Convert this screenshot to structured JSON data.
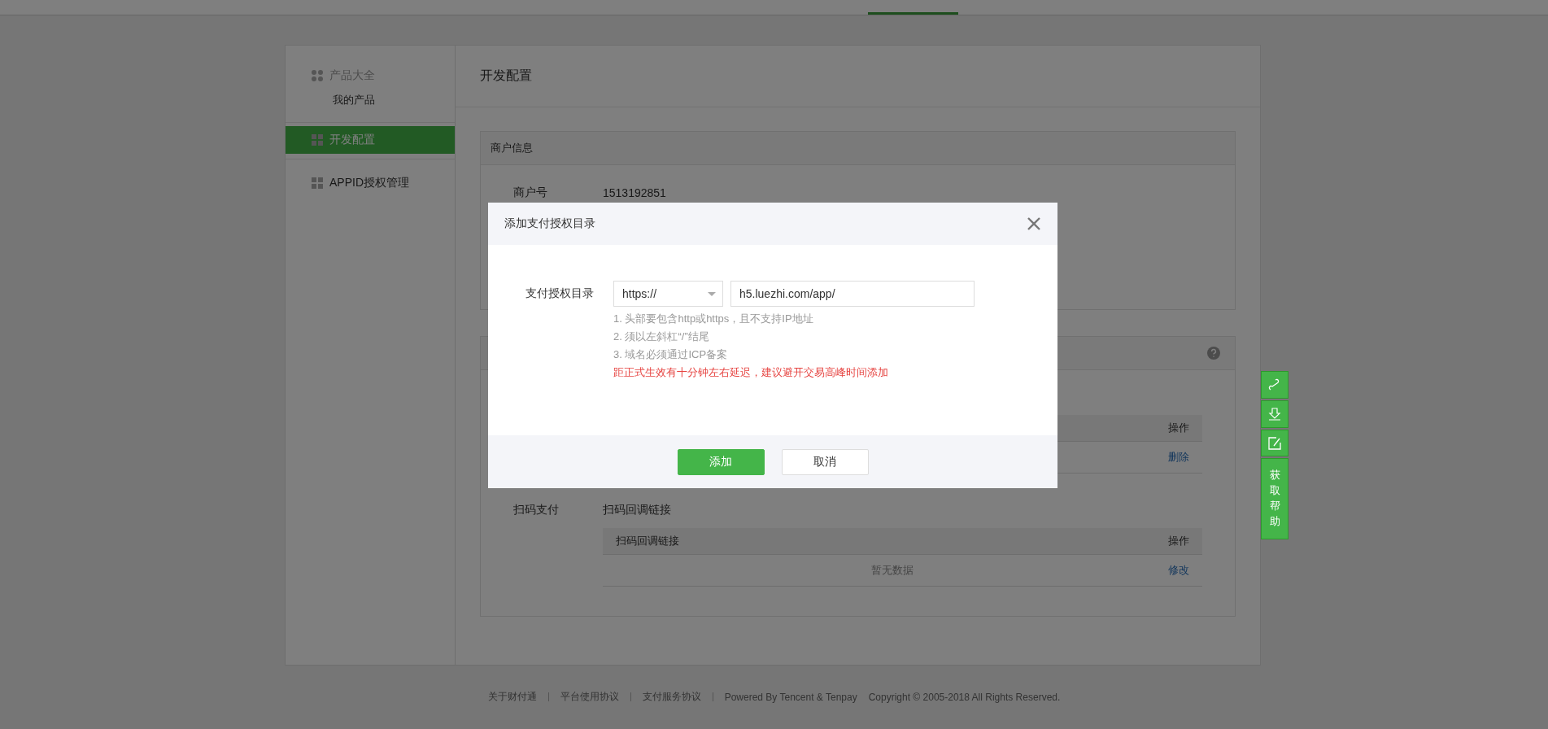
{
  "sidebar": {
    "group": {
      "title": "产品大全",
      "items": [
        {
          "label": "我的产品",
          "selected": false
        }
      ]
    },
    "items": [
      {
        "label": "开发配置",
        "selected": true
      },
      {
        "label": "APPID授权管理",
        "selected": false
      }
    ]
  },
  "page_title": "开发配置",
  "merchant_card": {
    "title": "商户信息",
    "fields": [
      {
        "label": "商户号",
        "value": "1513192851"
      }
    ]
  },
  "config_card": {
    "table": {
      "columns": [
        "操作"
      ],
      "rows": [
        {
          "action": "删除"
        }
      ]
    },
    "scan_pay": {
      "label": "扫码支付",
      "value": "扫码回调链接",
      "columns": [
        "扫码回调链接",
        "操作"
      ],
      "empty_text": "暂无数据",
      "action": "修改"
    }
  },
  "side_tools": [
    {
      "kind": "link"
    },
    {
      "kind": "download"
    },
    {
      "kind": "edit"
    },
    {
      "kind": "help",
      "label": "获取帮助"
    }
  ],
  "footer": {
    "links": [
      "关于财付通",
      "平台使用协议",
      "支付服务协议"
    ],
    "powered": "Powered By Tencent & Tenpay",
    "copyright": "Copyright © 2005-2018 All Rights Reserved."
  },
  "modal": {
    "title": "添加支付授权目录",
    "field_label": "支付授权目录",
    "scheme": "https://",
    "url": "h5.luezhi.com/app/",
    "hints": [
      "1. 头部要包含http或https，且不支持IP地址",
      "2. 须以左斜杠“/”结尾",
      "3. 域名必须通过ICP备案"
    ],
    "warning": "距正式生效有十分钟左右延迟，建议避开交易高峰时间添加",
    "buttons": [
      {
        "label": "添加",
        "kind": "primary"
      },
      {
        "label": "取消",
        "kind": "default"
      }
    ]
  }
}
